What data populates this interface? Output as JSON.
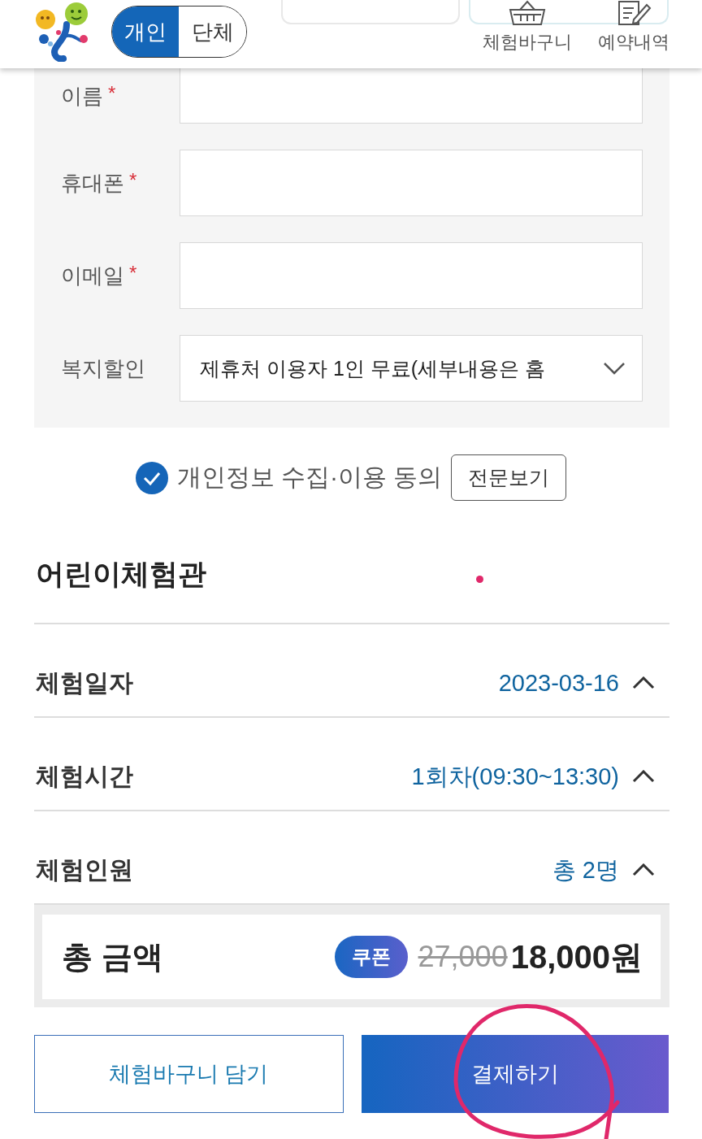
{
  "header": {
    "tabs": [
      {
        "label": "개인",
        "selected": true
      },
      {
        "label": "단체",
        "selected": false
      }
    ],
    "links": [
      {
        "label": "체험바구니",
        "kind": "basket"
      },
      {
        "label": "예약내역",
        "kind": "note"
      }
    ]
  },
  "form": {
    "required_mark": "*",
    "fields": [
      {
        "label": "이름",
        "required": true,
        "kind": "text"
      },
      {
        "label": "휴대폰",
        "required": true,
        "kind": "text"
      },
      {
        "label": "이메일",
        "required": true,
        "kind": "text"
      },
      {
        "label": "복지할인",
        "required": false,
        "kind": "select",
        "value": "제휴처 이용자 1인 무료(세부내용은 홈"
      }
    ]
  },
  "consent": {
    "checked": true,
    "label": "개인정보 수집·이용 동의",
    "button": "전문보기"
  },
  "program": {
    "title": "어린이체험관",
    "rows": [
      {
        "label": "체험일자",
        "value": "2023-03-16"
      },
      {
        "label": "체험시간",
        "value": "1회차(09:30~13:30)"
      },
      {
        "label": "체험인원",
        "value": "총 2명"
      }
    ]
  },
  "total": {
    "label": "총 금액",
    "badge": "쿠폰",
    "original_price": "27,000",
    "price": "18,000원"
  },
  "actions": [
    {
      "label": "체험바구니 담기",
      "kind": "outline"
    },
    {
      "label": "결제하기",
      "kind": "primary"
    }
  ]
}
